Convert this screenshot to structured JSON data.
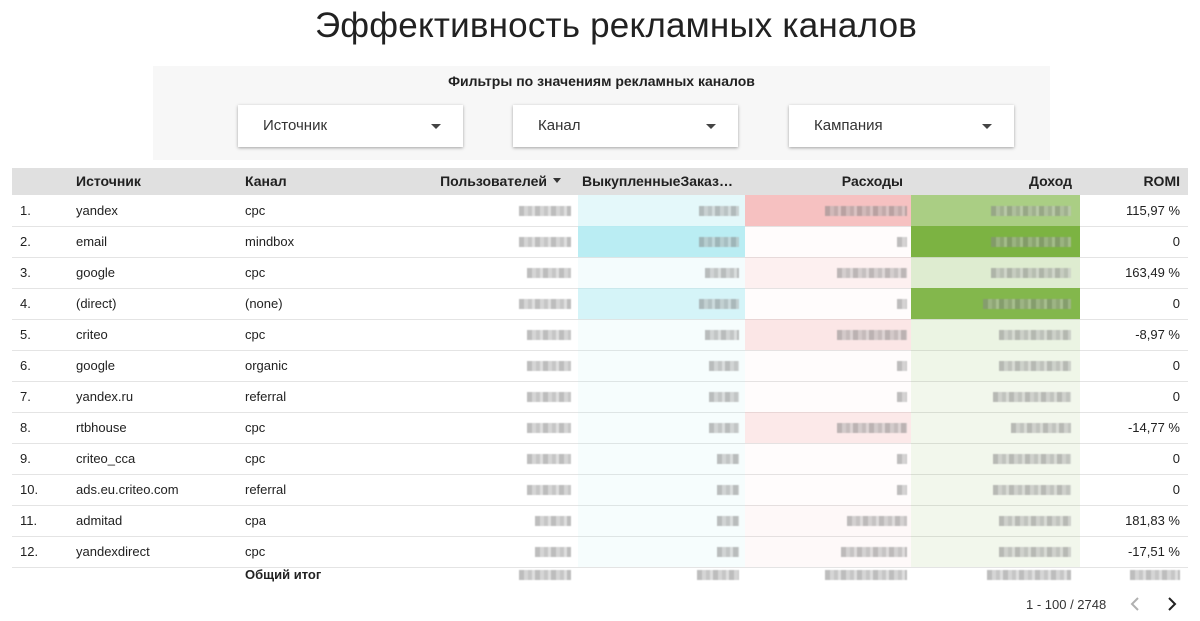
{
  "title": "Эффективность рекламных каналов",
  "filters": {
    "heading": "Фильтры по значениям рекламных каналов",
    "items": [
      {
        "label": "Источник"
      },
      {
        "label": "Канал"
      },
      {
        "label": "Кампания"
      }
    ]
  },
  "table": {
    "headers": {
      "source": "Источник",
      "channel": "Канал",
      "users": "Пользователей",
      "orders": "ВыкупленныеЗаказ…",
      "expenses": "Расходы",
      "income": "Доход",
      "romi": "ROMI"
    },
    "sort_icon": "sort-descending-icon",
    "rows": [
      {
        "num": "1.",
        "source": "yandex",
        "channel": "cpc",
        "romi": "115,97 %"
      },
      {
        "num": "2.",
        "source": "email",
        "channel": "mindbox",
        "romi": "0"
      },
      {
        "num": "3.",
        "source": "google",
        "channel": "cpc",
        "romi": "163,49 %"
      },
      {
        "num": "4.",
        "source": "(direct)",
        "channel": "(none)",
        "romi": "0"
      },
      {
        "num": "5.",
        "source": "criteo",
        "channel": "cpc",
        "romi": "-8,97 %"
      },
      {
        "num": "6.",
        "source": "google",
        "channel": "organic",
        "romi": "0"
      },
      {
        "num": "7.",
        "source": "yandex.ru",
        "channel": "referral",
        "romi": "0"
      },
      {
        "num": "8.",
        "source": "rtbhouse",
        "channel": "cpc",
        "romi": "-14,77 %"
      },
      {
        "num": "9.",
        "source": "criteo_cca",
        "channel": "cpc",
        "romi": "0"
      },
      {
        "num": "10.",
        "source": "ads.eu.criteo.com",
        "channel": "referral",
        "romi": "0"
      },
      {
        "num": "11.",
        "source": "admitad",
        "channel": "cpa",
        "romi": "181,83 %"
      },
      {
        "num": "12.",
        "source": "yandexdirect",
        "channel": "cpc",
        "romi": "-17,51 %"
      }
    ],
    "total_label": "Общий итог"
  },
  "pagination": {
    "range": "1 - 100 / 2748",
    "prev_icon": "chevron-left-icon",
    "next_icon": "chevron-right-icon"
  },
  "colors": {
    "orders": "#b2ebf2",
    "expenses": "#f4b6b6",
    "income": "#7cb342"
  }
}
